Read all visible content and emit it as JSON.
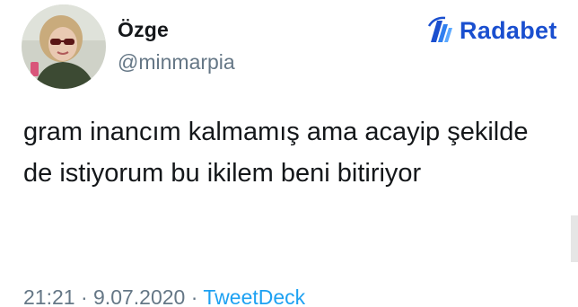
{
  "tweet": {
    "author": {
      "display_name": "Özge",
      "handle": "@minmarpia"
    },
    "text": "gram inancım kalmamış ama acayip şekilde de istiyorum bu ikilem beni bitiriyor",
    "time": "21:21",
    "date": "9.07.2020",
    "separator": "·",
    "source": "TweetDeck"
  },
  "watermark": {
    "text": "Radabet",
    "color": "#1a4fcf",
    "icon": "radabet-logo-icon"
  },
  "colors": {
    "text_primary": "#14171a",
    "text_secondary": "#657786",
    "link": "#1da1f2"
  }
}
